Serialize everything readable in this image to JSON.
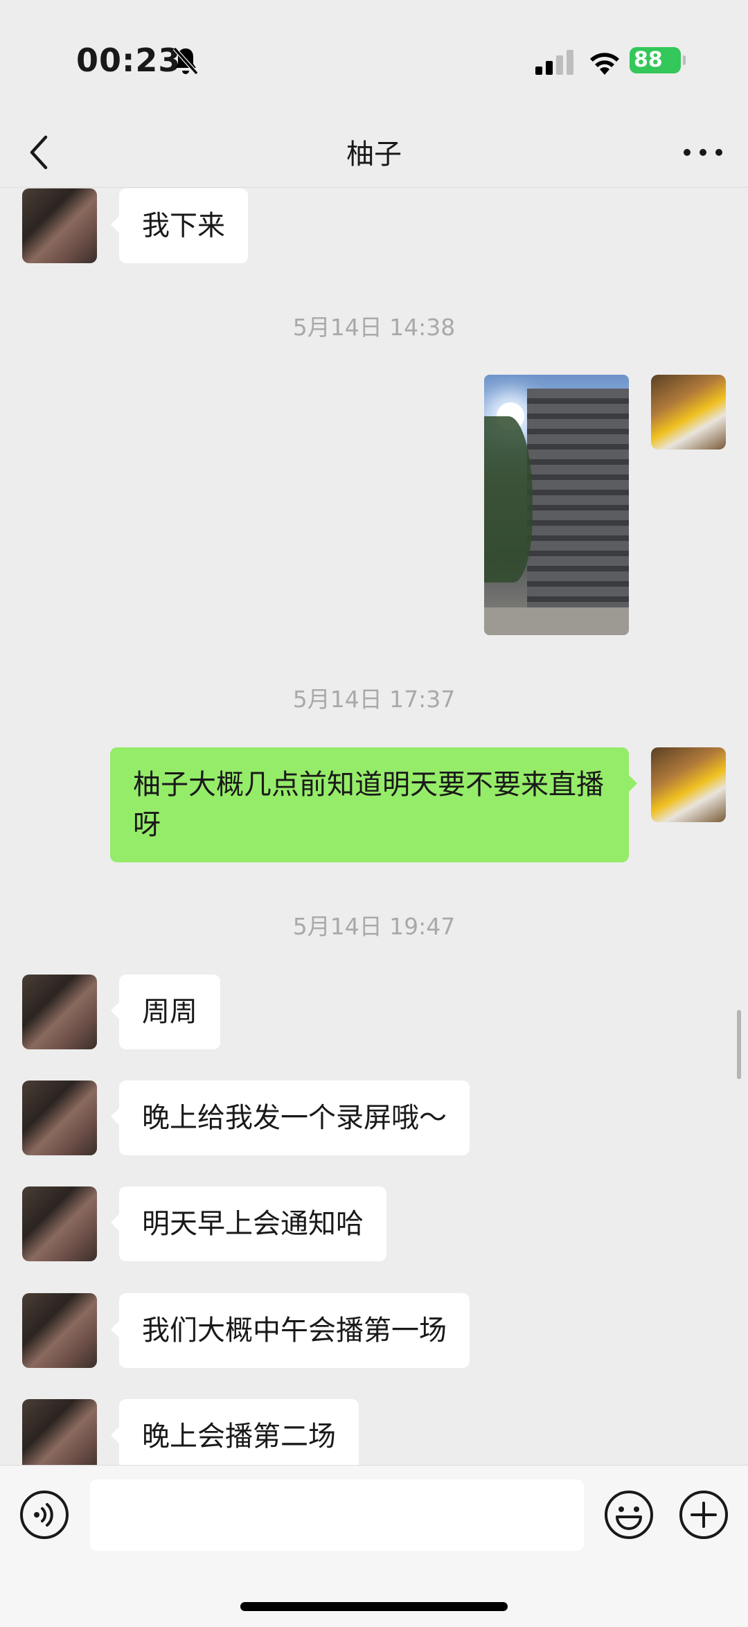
{
  "status_bar": {
    "time": "00:23",
    "battery": "88"
  },
  "header": {
    "title": "柚子"
  },
  "messages": [
    {
      "side": "left",
      "text": "我下来"
    },
    {
      "timestamp": "5月14日 14:38"
    },
    {
      "side": "right",
      "type": "image"
    },
    {
      "timestamp": "5月14日 17:37"
    },
    {
      "side": "right",
      "text": "柚子大概几点前知道明天要不要来直播呀"
    },
    {
      "timestamp": "5月14日 19:47"
    },
    {
      "side": "left",
      "text": "周周"
    },
    {
      "side": "left",
      "text": "晚上给我发一个录屏哦～"
    },
    {
      "side": "left",
      "text": "明天早上会通知哈"
    },
    {
      "side": "left",
      "text": "我们大概中午会播第一场"
    },
    {
      "side": "left",
      "text": "晚上会播第二场"
    }
  ],
  "input": {
    "value": "",
    "placeholder": ""
  },
  "icons": [
    "mute-icon",
    "signal-icon",
    "wifi-icon",
    "battery-icon",
    "back-icon",
    "more-icon",
    "voice-icon",
    "emoji-icon",
    "plus-icon"
  ],
  "colors": {
    "outgoing_bubble": "#95ec69",
    "incoming_bubble": "#ffffff",
    "background": "#ededed",
    "battery": "#34c759"
  }
}
